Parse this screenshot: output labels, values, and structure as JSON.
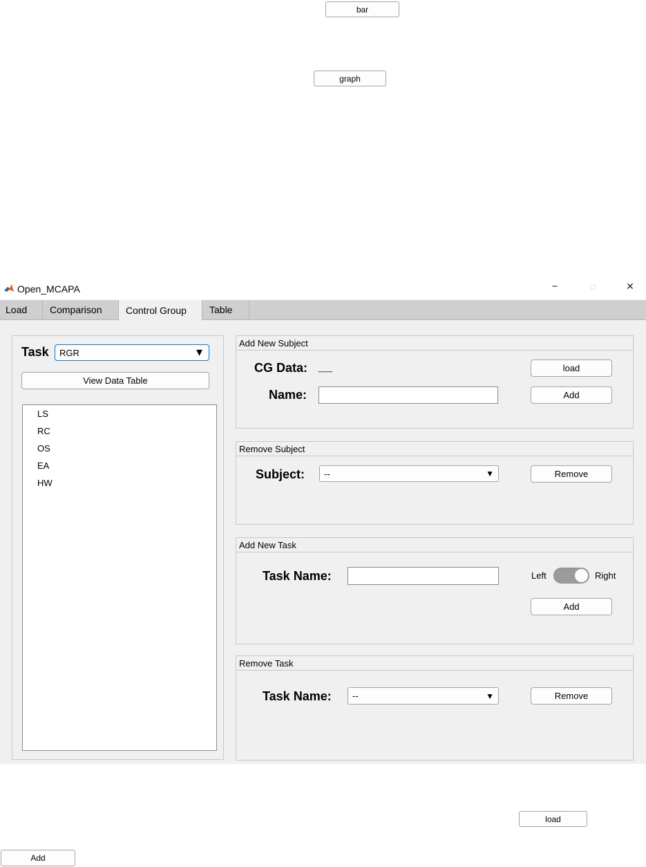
{
  "floating": {
    "bar_label": "bar",
    "graph_label": "graph",
    "load_label": "load",
    "add_label": "Add"
  },
  "window": {
    "title": "Open_MCAPA",
    "minimize_glyph": "−",
    "maximize_glyph": "□",
    "close_glyph": "✕"
  },
  "tabs": [
    {
      "label": "Load"
    },
    {
      "label": "Comparison"
    },
    {
      "label": "Control Group",
      "active": true
    },
    {
      "label": "Table"
    }
  ],
  "left_panel": {
    "task_label": "Task",
    "task_value": "RGR",
    "view_button": "View Data Table",
    "items": [
      "LS",
      "RC",
      "OS",
      "EA",
      "HW"
    ]
  },
  "add_subject": {
    "title": "Add New Subject",
    "cg_label": "CG Data:",
    "cg_value": "__",
    "name_label": "Name:",
    "name_value": "",
    "load_button": "load",
    "add_button": "Add"
  },
  "remove_subject": {
    "title": "Remove Subject",
    "subject_label": "Subject:",
    "subject_value": "--",
    "remove_button": "Remove"
  },
  "add_task": {
    "title": "Add New Task",
    "task_name_label": "Task Name:",
    "task_name_value": "",
    "switch_left": "Left",
    "switch_right": "Right",
    "add_button": "Add"
  },
  "remove_task": {
    "title": "Remove Task",
    "task_name_label": "Task Name:",
    "task_value": "--",
    "remove_button": "Remove"
  },
  "colors": {
    "accent": "#0078d7",
    "switch_track": "#9b9b9b"
  }
}
